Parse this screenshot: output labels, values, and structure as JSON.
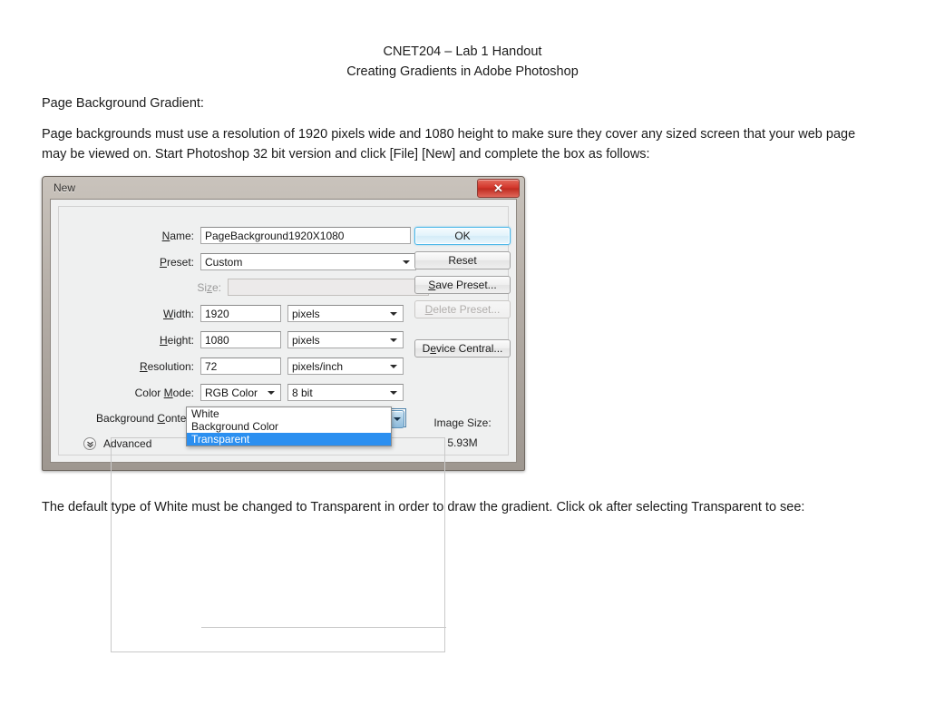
{
  "document": {
    "title_line1": "CNET204 – Lab 1 Handout",
    "title_line2": "Creating Gradients in Adobe Photoshop",
    "heading": "Page Background Gradient:",
    "intro_paragraph": "Page backgrounds must use a resolution of 1920 pixels wide and 1080 height to make sure they cover any sized screen that your web page may be viewed on. Start Photoshop 32 bit version and click [File] [New] and complete the box as follows:",
    "closing_paragraph": "The default type of White must be changed to Transparent in order to draw the gradient. Click ok after selecting Transparent to see:"
  },
  "dialog": {
    "title": "New",
    "close_icon": "close-icon",
    "close_glyph": "✕",
    "fields": {
      "name_label": "Name:",
      "name_value": "PageBackground1920X1080",
      "preset_label": "Preset:",
      "preset_value": "Custom",
      "size_label": "Size:",
      "size_value": "",
      "width_label": "Width:",
      "width_value": "1920",
      "width_unit": "pixels",
      "height_label": "Height:",
      "height_value": "1080",
      "height_unit": "pixels",
      "resolution_label": "Resolution:",
      "resolution_value": "72",
      "resolution_unit": "pixels/inch",
      "color_mode_label": "Color Mode:",
      "color_mode_value": "RGB Color",
      "color_depth_value": "8 bit",
      "background_contents_label": "Background Contents:",
      "background_contents_value": "Transparent"
    },
    "background_contents_options": [
      {
        "label": "White",
        "selected": false
      },
      {
        "label": "Background Color",
        "selected": false
      },
      {
        "label": "Transparent",
        "selected": true
      }
    ],
    "buttons": {
      "ok": "OK",
      "reset": "Reset",
      "save_preset": "Save Preset...",
      "delete_preset": "Delete Preset...",
      "device_central": "Device Central..."
    },
    "image_size": {
      "label": "Image Size:",
      "value": "5.93M"
    },
    "advanced": {
      "label": "Advanced",
      "expander_icon": "chevron-double-down-icon",
      "expander_glyph": "⌄"
    },
    "colors": {
      "highlight_blue": "#2b8ff0",
      "close_red": "#d2352a",
      "focus_border": "#4a7fa8",
      "titlebar": "#b5aea7"
    }
  }
}
